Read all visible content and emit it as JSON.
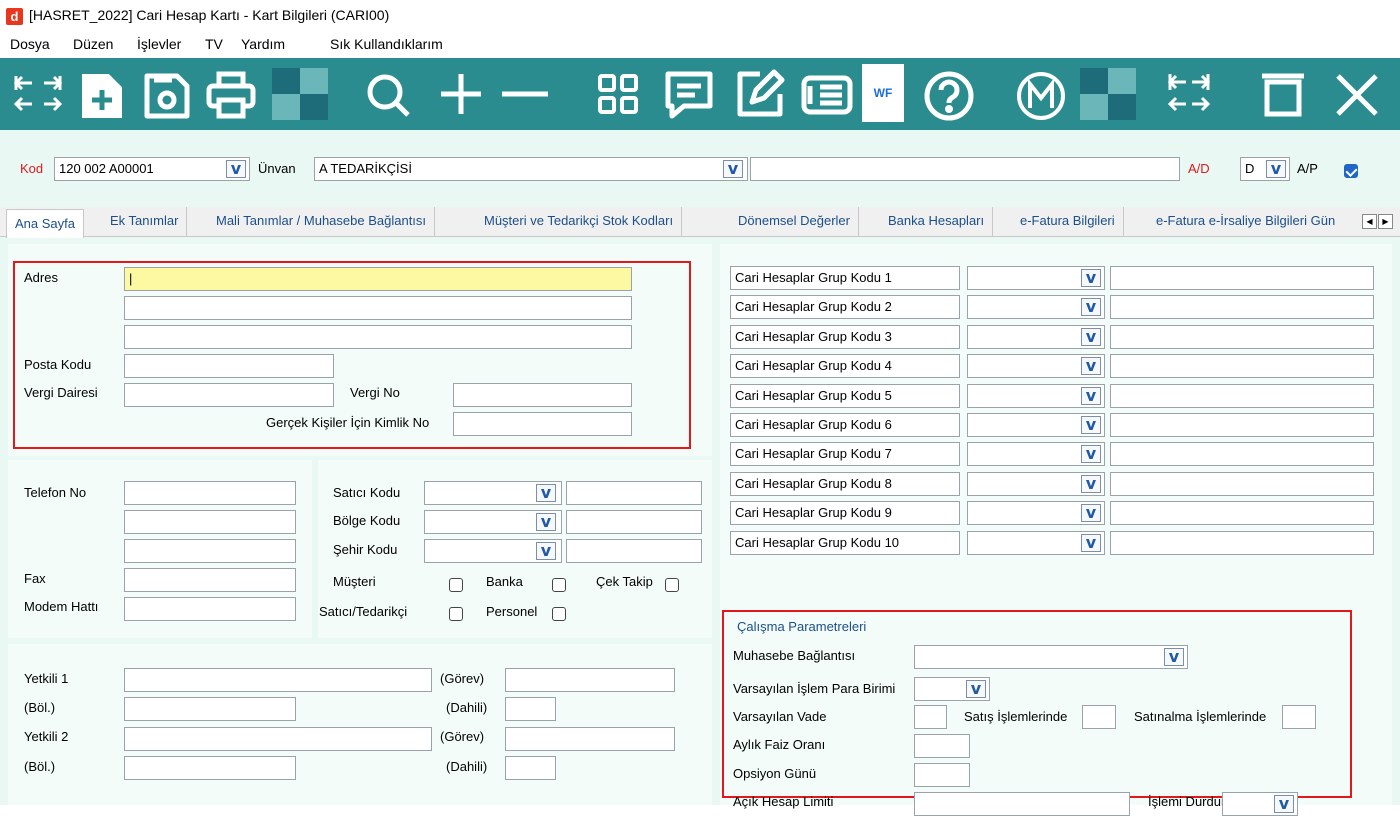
{
  "window": {
    "title": "[HASRET_2022] Cari Hesap Kartı - Kart Bilgileri (CARI00)",
    "logo_letter": "d"
  },
  "menu": [
    "Dosya",
    "Düzen",
    "İşlevler",
    "TV",
    "Yardım",
    "Sık Kullandıklarım"
  ],
  "toolbar": {
    "icons": [
      "resize-arrows-icon",
      "new-document-icon",
      "save-icon",
      "print-icon",
      "search-icon",
      "plus-icon",
      "minus-icon",
      "grid-icon",
      "comment-icon",
      "edit-icon",
      "list-icon",
      "wf-icon",
      "help-icon",
      "m-circle-icon",
      "resize-arrows-icon",
      "delete-icon",
      "close-icon"
    ],
    "wf_label": "WF"
  },
  "header": {
    "kod_label": "Kod",
    "kod_value": "120 002 A00001",
    "unvan_label": "Ünvan",
    "unvan_value": "A TEDARİKÇİSİ",
    "unvan2_value": "",
    "ad_label": "A/D",
    "ad_value": "D",
    "ap_label": "A/P",
    "ap_checked": true
  },
  "tabs": [
    "Ana Sayfa",
    "Ek Tanımlar",
    "Mali Tanımlar / Muhasebe Bağlantısı",
    "Müşteri ve Tedarikçi Stok Kodları",
    "Dönemsel Değerler",
    "Banka Hesapları",
    "e-Fatura Bilgileri",
    "e-Fatura e-İrsaliye Bilgileri Gün"
  ],
  "address": {
    "adres_label": "Adres",
    "posta_label": "Posta Kodu",
    "vergi_dairesi_label": "Vergi Dairesi",
    "vergi_no_label": "Vergi No",
    "kimlik_label": "Gerçek Kişiler İçin Kimlik No",
    "adres_value": "|"
  },
  "contact": {
    "telefon_label": "Telefon No",
    "fax_label": "Fax",
    "modem_label": "Modem Hattı"
  },
  "codes": {
    "satici_label": "Satıcı Kodu",
    "bolge_label": "Bölge Kodu",
    "sehir_label": "Şehir Kodu",
    "musteri_label": "Müşteri",
    "banka_label": "Banka",
    "cek_label": "Çek Takip",
    "satici_tedarikci_label": "Satıcı/Tedarikçi",
    "personel_label": "Personel"
  },
  "yetkili": {
    "yetkili1_label": "Yetkili 1",
    "yetkili2_label": "Yetkili 2",
    "gorev_label": "(Görev)",
    "bol_label": "(Böl.)",
    "dahili_label": "(Dahili)"
  },
  "group_codes": [
    "Cari Hesaplar Grup Kodu 1",
    "Cari Hesaplar Grup Kodu 2",
    "Cari Hesaplar Grup Kodu 3",
    "Cari Hesaplar Grup Kodu 4",
    "Cari Hesaplar Grup Kodu 5",
    "Cari Hesaplar Grup Kodu 6",
    "Cari Hesaplar Grup Kodu 7",
    "Cari Hesaplar Grup Kodu 8",
    "Cari Hesaplar Grup Kodu 9",
    "Cari Hesaplar Grup Kodu 10"
  ],
  "params": {
    "title": "Çalışma Parametreleri",
    "muhasebe_label": "Muhasebe Bağlantısı",
    "para_label": "Varsayılan İşlem Para Birimi",
    "vade_label": "Varsayılan Vade",
    "satis_label": "Satış İşlemlerinde",
    "satinalma_label": "Satınalma İşlemlerinde",
    "faiz_label": "Aylık Faiz Oranı",
    "opsiyon_label": "Opsiyon Günü",
    "acik_label": "Açık Hesap Limiti",
    "islemi_label": "İşlemi Durdur"
  },
  "colors": {
    "toolbar": "#2a8c8e",
    "form_bg": "#eaf8f4",
    "highlight_box": "#e3181d",
    "active_field": "#fdf8a2"
  }
}
